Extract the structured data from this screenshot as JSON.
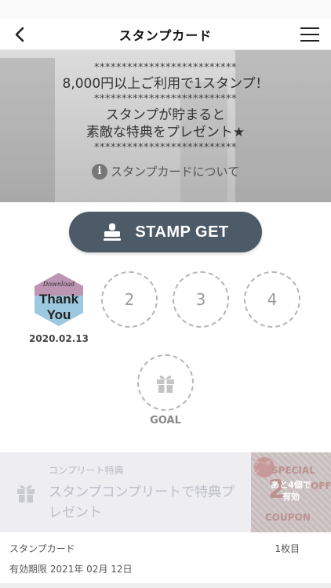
{
  "header": {
    "title": "スタンプカード"
  },
  "hero": {
    "stars": "**************************",
    "line1": "8,000円以上ご利用で1スタンプ！",
    "line2": "スタンプが貯まると",
    "line3": "素敵な特典をプレゼント★",
    "about_link": "スタンプカードについて",
    "info_glyph": "i"
  },
  "stamp_button": {
    "label": "STAMP GET"
  },
  "stamps": {
    "stamp1_line1": "Download",
    "stamp1_line2": "Thank",
    "stamp1_line3": "You",
    "stamp1_date": "2020.02.13",
    "slot2": "2",
    "slot3": "3",
    "slot4": "4",
    "goal_label": "GOAL"
  },
  "complete": {
    "label": "コンプリート特典",
    "description": "スタンプコンプリートで特典プレゼント",
    "coupon_badge": "クーポン",
    "coupon_special": "SPECIAL",
    "coupon_number": "2",
    "coupon_off": "OFF",
    "coupon_word": "COUPON",
    "remaining_line1": "あと4個で",
    "remaining_line2": "有効"
  },
  "footer": {
    "card_label": "スタンプカード",
    "card_count": "1枚目",
    "expiry": "有効期限 2021年 02月 12日"
  },
  "colors": {
    "button_bg": "#4d5b68",
    "stamp_border": "#b5b5b5",
    "complete_bg": "#ededf2",
    "coupon_accent": "#d79c9c"
  }
}
